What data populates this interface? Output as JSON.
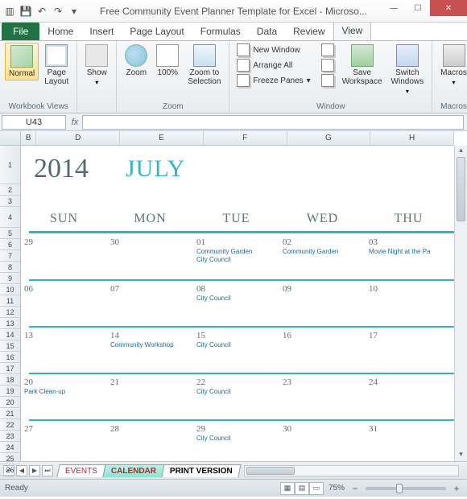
{
  "titlebar": {
    "title": "Free Community Event Planner Template for Excel  -  Microso..."
  },
  "tabs": {
    "file": "File",
    "home": "Home",
    "insert": "Insert",
    "pagelayout": "Page Layout",
    "formulas": "Formulas",
    "data": "Data",
    "review": "Review",
    "view": "View"
  },
  "ribbon": {
    "views": {
      "normal": "Normal",
      "page": "Page\nLayout",
      "label": "Workbook Views"
    },
    "show": {
      "btn": "Show",
      "label": ""
    },
    "zoom": {
      "zoom": "Zoom",
      "z100": "100%",
      "sel": "Zoom to\nSelection",
      "label": "Zoom"
    },
    "window": {
      "newwin": "New Window",
      "arrange": "Arrange All",
      "freeze": "Freeze Panes",
      "save": "Save\nWorkspace",
      "switch": "Switch\nWindows",
      "label": "Window"
    },
    "macros": {
      "btn": "Macros",
      "label": "Macros"
    }
  },
  "namebox": "U43",
  "fx": "fx",
  "colheaders": [
    "B",
    "D",
    "E",
    "F",
    "G",
    "H"
  ],
  "rowheaders_top": [
    "1",
    "2",
    "3"
  ],
  "rowheaders": [
    "4",
    "5",
    "6",
    "7",
    "8",
    "9",
    "10",
    "11",
    "12",
    "13",
    "14",
    "15",
    "16",
    "17",
    "18",
    "19",
    "20",
    "21",
    "22",
    "23",
    "24",
    "25",
    "26"
  ],
  "calendar": {
    "year": "2014",
    "month": "JULY",
    "days": [
      "SUN",
      "MON",
      "TUE",
      "WED",
      "THU"
    ],
    "weeks": [
      [
        {
          "n": "29"
        },
        {
          "n": "30"
        },
        {
          "n": "01",
          "e": [
            "Community Garden",
            "City Council"
          ]
        },
        {
          "n": "02",
          "e": [
            "Community Garden"
          ]
        },
        {
          "n": "03",
          "e": [
            "Movie Night at the Pa"
          ]
        }
      ],
      [
        {
          "n": "06"
        },
        {
          "n": "07"
        },
        {
          "n": "08",
          "e": [
            "City Council"
          ]
        },
        {
          "n": "09"
        },
        {
          "n": "10"
        }
      ],
      [
        {
          "n": "13"
        },
        {
          "n": "14",
          "e": [
            "Community Workshop"
          ]
        },
        {
          "n": "15",
          "e": [
            "City Council"
          ]
        },
        {
          "n": "16"
        },
        {
          "n": "17"
        }
      ],
      [
        {
          "n": "20",
          "e": [
            "Park Clean-up"
          ]
        },
        {
          "n": "21"
        },
        {
          "n": "22",
          "e": [
            "City Council"
          ]
        },
        {
          "n": "23"
        },
        {
          "n": "24"
        }
      ],
      [
        {
          "n": "27"
        },
        {
          "n": "28"
        },
        {
          "n": "29",
          "e": [
            "City Council"
          ]
        },
        {
          "n": "30"
        },
        {
          "n": "31"
        }
      ]
    ]
  },
  "sheettabs": {
    "events": "EVENTS",
    "calendar": "CALENDAR",
    "print": "PRINT VERSION"
  },
  "status": {
    "ready": "Ready",
    "zoom": "75%"
  }
}
